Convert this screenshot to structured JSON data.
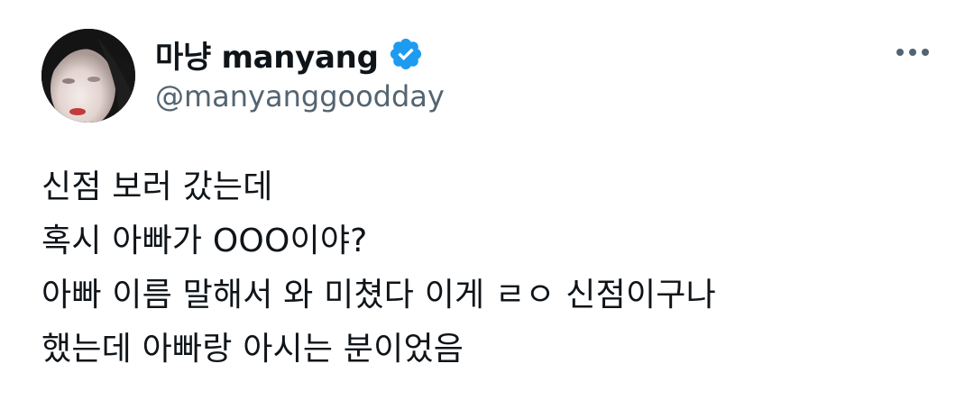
{
  "author": {
    "display_name": "마냥 manyang",
    "handle": "@manyanggoodday",
    "verified": true
  },
  "tweet": {
    "lines": [
      "신점 보러 갔는데",
      "혹시 아빠가 OOO이야?",
      "아빠 이름 말해서 와 미쳤다 이게 ㄹㅇ 신점이구나",
      "했는데 아빠랑 아시는 분이었음"
    ]
  },
  "icons": {
    "verified": "verified-badge-icon",
    "more": "more-options-icon"
  },
  "colors": {
    "text": "#0f1419",
    "secondary": "#536471",
    "verified": "#1d9bf0"
  }
}
